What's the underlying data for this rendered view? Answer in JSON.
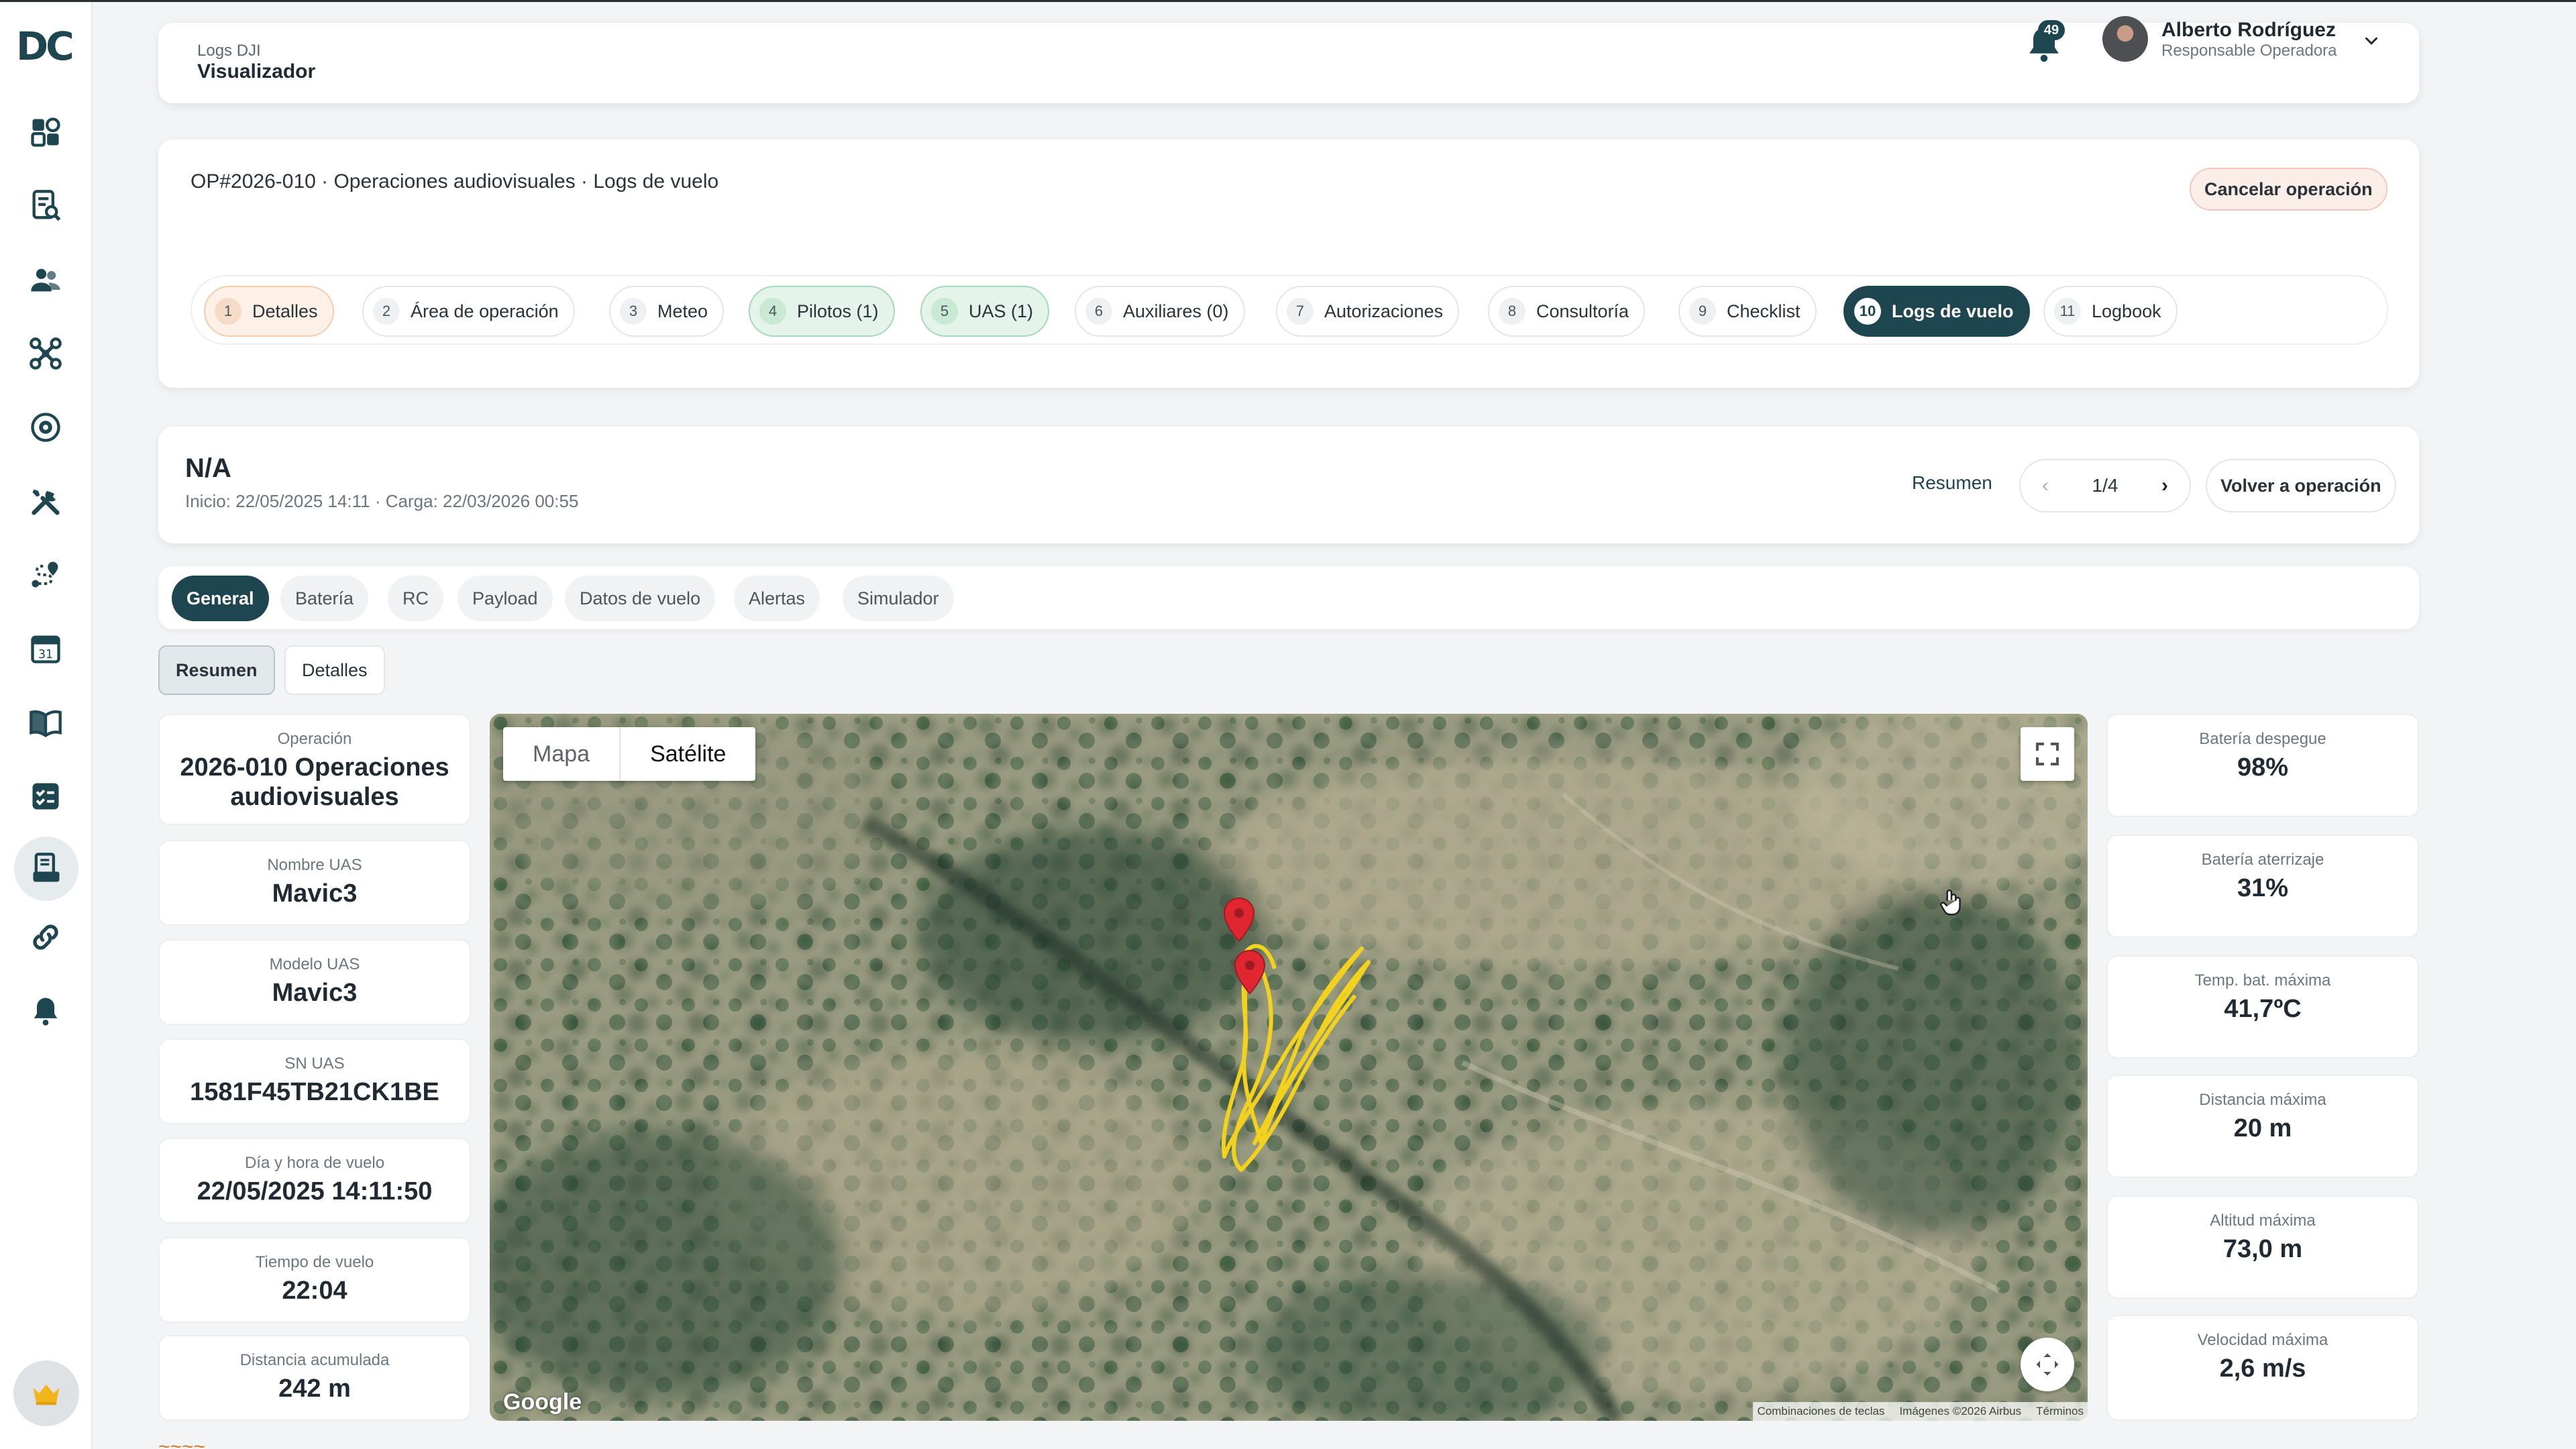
{
  "colors": {
    "brand": "#1e4650",
    "orange_step": "#fdf0e6",
    "green_step": "#e4f4ea",
    "track": "#f2d21e",
    "marker": "#e02631"
  },
  "sidebar": {
    "logo": "DC",
    "icons": [
      "dashboard-icon",
      "document-search-icon",
      "users-icon",
      "drone-icon",
      "target-icon",
      "tools-icon",
      "route-icon",
      "calendar-icon",
      "book-icon",
      "checklist-icon",
      "logs-icon",
      "link-icon",
      "bell-icon"
    ],
    "calendar_day": "31",
    "bottom_avatar": "crown-icon"
  },
  "header": {
    "section": "Logs DJI",
    "title": "Visualizador",
    "notifications": "49",
    "user_name": "Alberto Rodríguez",
    "user_role": "Responsable Operadora"
  },
  "operation": {
    "title": "OP#2026-010 · Operaciones audiovisuales · Logs de vuelo",
    "cancel_label": "Cancelar operación",
    "steps": [
      {
        "num": "1",
        "label": "Detalles"
      },
      {
        "num": "2",
        "label": "Área de operación"
      },
      {
        "num": "3",
        "label": "Meteo"
      },
      {
        "num": "4",
        "label": "Pilotos (1)"
      },
      {
        "num": "5",
        "label": "UAS (1)"
      },
      {
        "num": "6",
        "label": "Auxiliares (0)"
      },
      {
        "num": "7",
        "label": "Autorizaciones"
      },
      {
        "num": "8",
        "label": "Consultoría"
      },
      {
        "num": "9",
        "label": "Checklist"
      },
      {
        "num": "10",
        "label": "Logs de vuelo"
      },
      {
        "num": "11",
        "label": "Logbook"
      }
    ]
  },
  "flight": {
    "name": "N/A",
    "meta": "Inicio: 22/05/2025 14:11 · Carga: 22/03/2026 00:55",
    "resumen_label": "Resumen",
    "pager_prev": "‹",
    "pager_value": "1/4",
    "pager_next": "›",
    "back_label": "Volver a operación"
  },
  "tabs": [
    "General",
    "Batería",
    "RC",
    "Payload",
    "Datos de vuelo",
    "Alertas",
    "Simulador"
  ],
  "subtabs": [
    "Resumen",
    "Detalles"
  ],
  "left_cards": [
    {
      "label": "Operación",
      "value": "2026-010 Operaciones audiovisuales"
    },
    {
      "label": "Nombre UAS",
      "value": "Mavic3"
    },
    {
      "label": "Modelo UAS",
      "value": "Mavic3"
    },
    {
      "label": "SN UAS",
      "value": "1581F45TB21CK1BE"
    },
    {
      "label": "Día y hora de vuelo",
      "value": "22/05/2025 14:11:50"
    },
    {
      "label": "Tiempo de vuelo",
      "value": "22:04"
    },
    {
      "label": "Distancia acumulada",
      "value": "242 m"
    }
  ],
  "right_cards": [
    {
      "label": "Batería despegue",
      "value": "98%"
    },
    {
      "label": "Batería aterrizaje",
      "value": "31%"
    },
    {
      "label": "Temp. bat. máxima",
      "value": "41,7ºC"
    },
    {
      "label": "Distancia máxima",
      "value": "20 m"
    },
    {
      "label": "Altitud máxima",
      "value": "73,0 m"
    },
    {
      "label": "Velocidad máxima",
      "value": "2,6 m/s"
    }
  ],
  "map": {
    "type_map": "Mapa",
    "type_satellite": "Satélite",
    "google": "Google",
    "shortcuts": "Combinaciones de teclas",
    "imagery": "Imágenes ©2026 Airbus",
    "terms": "Términos"
  },
  "partial_text": "~~~~"
}
